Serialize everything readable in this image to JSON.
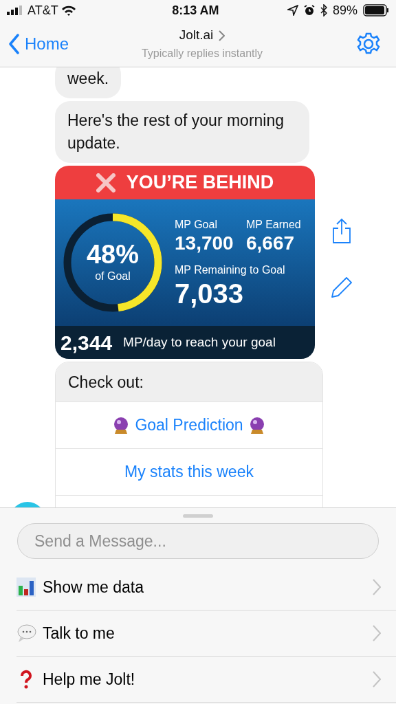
{
  "status_bar": {
    "carrier": "AT&T",
    "time": "8:13 AM",
    "battery": "89%"
  },
  "nav": {
    "back": "Home",
    "title": "Jolt.ai",
    "subtitle": "Typically replies instantly"
  },
  "messages": [
    {
      "kind": "text",
      "text": "week."
    },
    {
      "kind": "text",
      "text": "Here's the rest of your morning update."
    },
    {
      "kind": "report",
      "banner": "YOU’RE BEHIND",
      "percent": "48%",
      "percent_label": "of Goal",
      "stats": [
        {
          "label": "MP Goal",
          "value": "13,700"
        },
        {
          "label": "MP Earned",
          "value": "6,667"
        },
        {
          "label": "MP Remaining to Goal",
          "value": "7,033"
        }
      ],
      "daily_value": "2,344",
      "daily_label": "MP/day to reach your goal"
    },
    {
      "kind": "quick_replies",
      "title": "Check out:",
      "buttons": [
        {
          "label": "Goal Prediction"
        },
        {
          "label": "My stats this week"
        }
      ]
    }
  ],
  "composer": {
    "placeholder": "Send a Message..."
  },
  "menu": [
    {
      "label": "Show me data"
    },
    {
      "label": "Talk to me"
    },
    {
      "label": "Help me Jolt!"
    }
  ]
}
